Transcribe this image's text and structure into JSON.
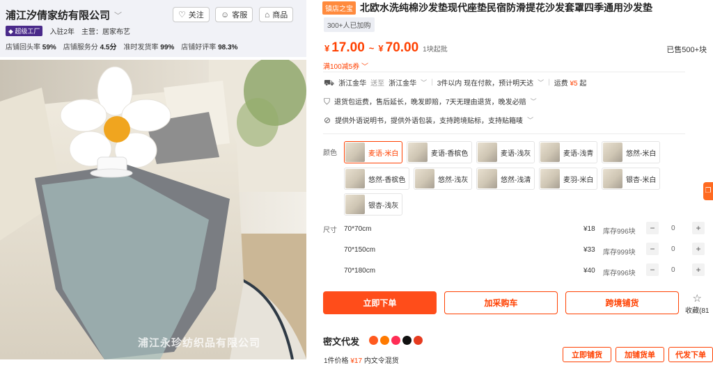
{
  "shop": {
    "name": "浦江汐倩家纺有限公司",
    "follow": "关注",
    "service": "客服",
    "goods": "商品",
    "tier": "超级工厂",
    "years": "入驻2年",
    "category_label": "主营：",
    "category": "居家布艺",
    "metrics": [
      {
        "label": "店铺回头率",
        "value": "59%"
      },
      {
        "label": "店铺服务分",
        "value": "4.5分"
      },
      {
        "label": "准时发货率",
        "value": "99%"
      },
      {
        "label": "店铺好评率",
        "value": "98.3%"
      }
    ]
  },
  "image": {
    "watermark": "浦江永珍纺织品有限公司"
  },
  "product": {
    "store_tag": "镇店之宝",
    "title": "北欧水洗纯棉沙发垫现代座垫民宿防滑提花沙发套罩四季通用沙发垫",
    "joined": "300+人已加购",
    "price_min_currency": "¥",
    "price_min": "17.00",
    "price_sep": "~",
    "price_max_currency": "¥",
    "price_max": "70.00",
    "moq": "1块起批",
    "sold": "已售500+块",
    "coupon": "满100减5券"
  },
  "shipping": {
    "from": "浙江金华",
    "to_label": "送至",
    "to": "浙江金华",
    "dispatch": "3件以内 现在付款，预计明天达",
    "fee_label": "运费",
    "fee": "¥5",
    "fee_suffix": "起"
  },
  "guarantee": "退货包运费，售后延长，晚发即赔，7天无理由退货，晚发必赔",
  "export": "提供外语说明书，提供外语包装，支持跨境贴标，支持贴箱唛",
  "colors": {
    "label": "颜色",
    "options": [
      "麦语-米白",
      "麦语-香槟色",
      "麦语-浅灰",
      "麦语-浅青",
      "悠然-米白",
      "悠然-香槟色",
      "悠然-浅灰",
      "悠然-浅清",
      "麦羽-米白",
      "银杏-米白",
      "银杏-浅灰"
    ]
  },
  "sizes": {
    "label": "尺寸",
    "rows": [
      {
        "name": "70*70cm",
        "price": "¥18",
        "stock": "库存996块",
        "qty": "0"
      },
      {
        "name": "70*150cm",
        "price": "¥33",
        "stock": "库存999块",
        "qty": "0"
      },
      {
        "name": "70*180cm",
        "price": "¥40",
        "stock": "库存996块",
        "qty": "0"
      }
    ]
  },
  "actions": {
    "buy": "立即下单",
    "cart": "加采购车",
    "cross": "跨境铺货",
    "fav": "收藏(81"
  },
  "dropship": {
    "title": "密文代发",
    "btn1": "立即铺货",
    "btn2": "加铺货单",
    "btn3": "代发下单",
    "bottom_a": "1件价格",
    "bottom_price": "¥17",
    "bottom_b": "内文令混货"
  },
  "colors_brand": {
    "accent": "#ff4000",
    "shop_bg": "#f1f2f7"
  }
}
